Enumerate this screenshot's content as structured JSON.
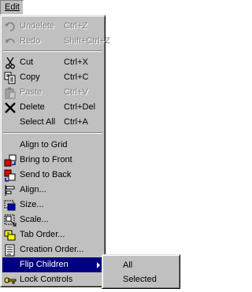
{
  "menubar": {
    "edit_label": "Edit"
  },
  "menu": {
    "items": [
      {
        "label": "Undelete",
        "shortcut": "Ctrl+Z",
        "icon": "undo-icon",
        "disabled": true
      },
      {
        "label": "Redo",
        "shortcut": "Shift+Ctrl+Z",
        "icon": "redo-icon",
        "disabled": true
      },
      {
        "label": "Cut",
        "shortcut": "Ctrl+X",
        "icon": "scissors-icon",
        "disabled": false
      },
      {
        "label": "Copy",
        "shortcut": "Ctrl+C",
        "icon": "copy-icon",
        "disabled": false
      },
      {
        "label": "Paste",
        "shortcut": "Ctrl+V",
        "icon": "paste-icon",
        "disabled": true
      },
      {
        "label": "Delete",
        "shortcut": "Ctrl+Del",
        "icon": "delete-x-icon",
        "disabled": false
      },
      {
        "label": "Select All",
        "shortcut": "Ctrl+A",
        "icon": "",
        "disabled": false
      },
      {
        "label": "Align to Grid",
        "shortcut": "",
        "icon": "",
        "disabled": false
      },
      {
        "label": "Bring to Front",
        "shortcut": "",
        "icon": "bring-to-front-icon",
        "disabled": false
      },
      {
        "label": "Send to Back",
        "shortcut": "",
        "icon": "send-to-back-icon",
        "disabled": false
      },
      {
        "label": "Align...",
        "shortcut": "",
        "icon": "align-icon",
        "disabled": false
      },
      {
        "label": "Size...",
        "shortcut": "",
        "icon": "size-icon",
        "disabled": false
      },
      {
        "label": "Scale...",
        "shortcut": "",
        "icon": "scale-icon",
        "disabled": false
      },
      {
        "label": "Tab Order...",
        "shortcut": "",
        "icon": "tab-order-icon",
        "disabled": false
      },
      {
        "label": "Creation Order...",
        "shortcut": "",
        "icon": "creation-order-icon",
        "disabled": false
      },
      {
        "label": "Flip Children",
        "shortcut": "",
        "icon": "",
        "disabled": false,
        "highlighted": true
      },
      {
        "label": "Lock Controls",
        "shortcut": "",
        "icon": "key-icon",
        "disabled": false
      }
    ]
  },
  "submenu": {
    "items": [
      {
        "label": "All"
      },
      {
        "label": "Selected"
      }
    ]
  },
  "colors": {
    "menu_bg": "#c0c0c0",
    "highlight_bg": "#000080",
    "disabled_text": "#808080"
  }
}
